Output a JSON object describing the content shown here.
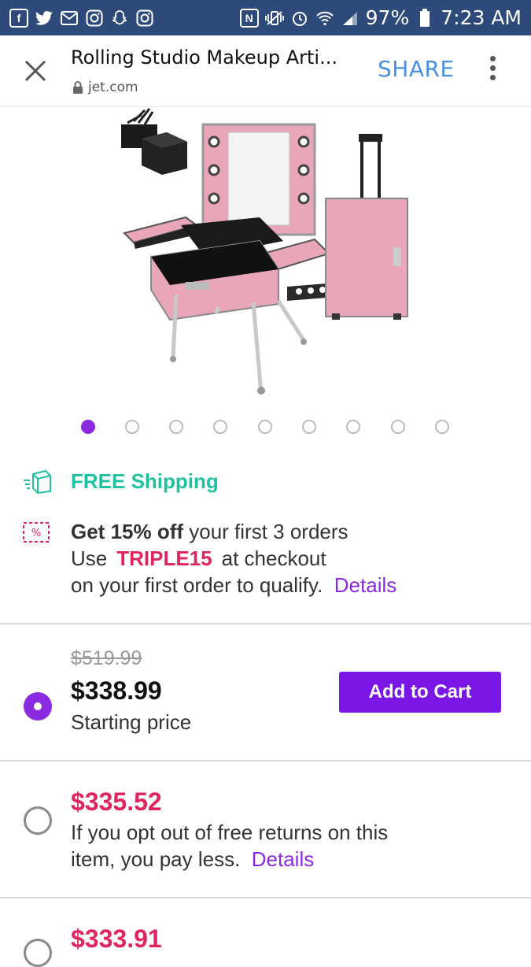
{
  "status_bar": {
    "left_icons": [
      "facebook-icon",
      "twitter-icon",
      "gmail-icon",
      "instagram-icon",
      "snapchat-icon",
      "instagram-icon"
    ],
    "right_icons": [
      "nfc-icon",
      "vibrate-icon",
      "alarm-icon",
      "wifi-icon",
      "signal-icon",
      "battery-icon"
    ],
    "battery": "97%",
    "time": "7:23 AM"
  },
  "browser": {
    "page_title": "Rolling Studio Makeup Arti...",
    "domain": "jet.com",
    "share_label": "SHARE"
  },
  "gallery": {
    "image_count": 9,
    "active_index": 0
  },
  "shipping": {
    "label": "FREE Shipping"
  },
  "promo": {
    "headline_bold": "Get 15% off",
    "headline_rest": " your first 3 orders",
    "use_label": "Use",
    "code": "TRIPLE15",
    "after_code": "at checkout",
    "line3": "on your first order to qualify.",
    "details_label": "Details"
  },
  "options": [
    {
      "selected": true,
      "old_price": "$519.99",
      "price": "$338.99",
      "description": "Starting price",
      "button_label": "Add to Cart"
    },
    {
      "selected": false,
      "price": "$335.52",
      "description_line1": "If you opt out of free returns on this",
      "description_line2": "item, you pay less.",
      "details_label": "Details"
    },
    {
      "selected": false,
      "price": "$333.91"
    }
  ],
  "colors": {
    "status_bar": "#2e4a7a",
    "accent_purple": "#7a16e6",
    "shipping_green": "#1ec2a0",
    "promo_pink": "#e0245e",
    "share_blue": "#4a90e2"
  }
}
